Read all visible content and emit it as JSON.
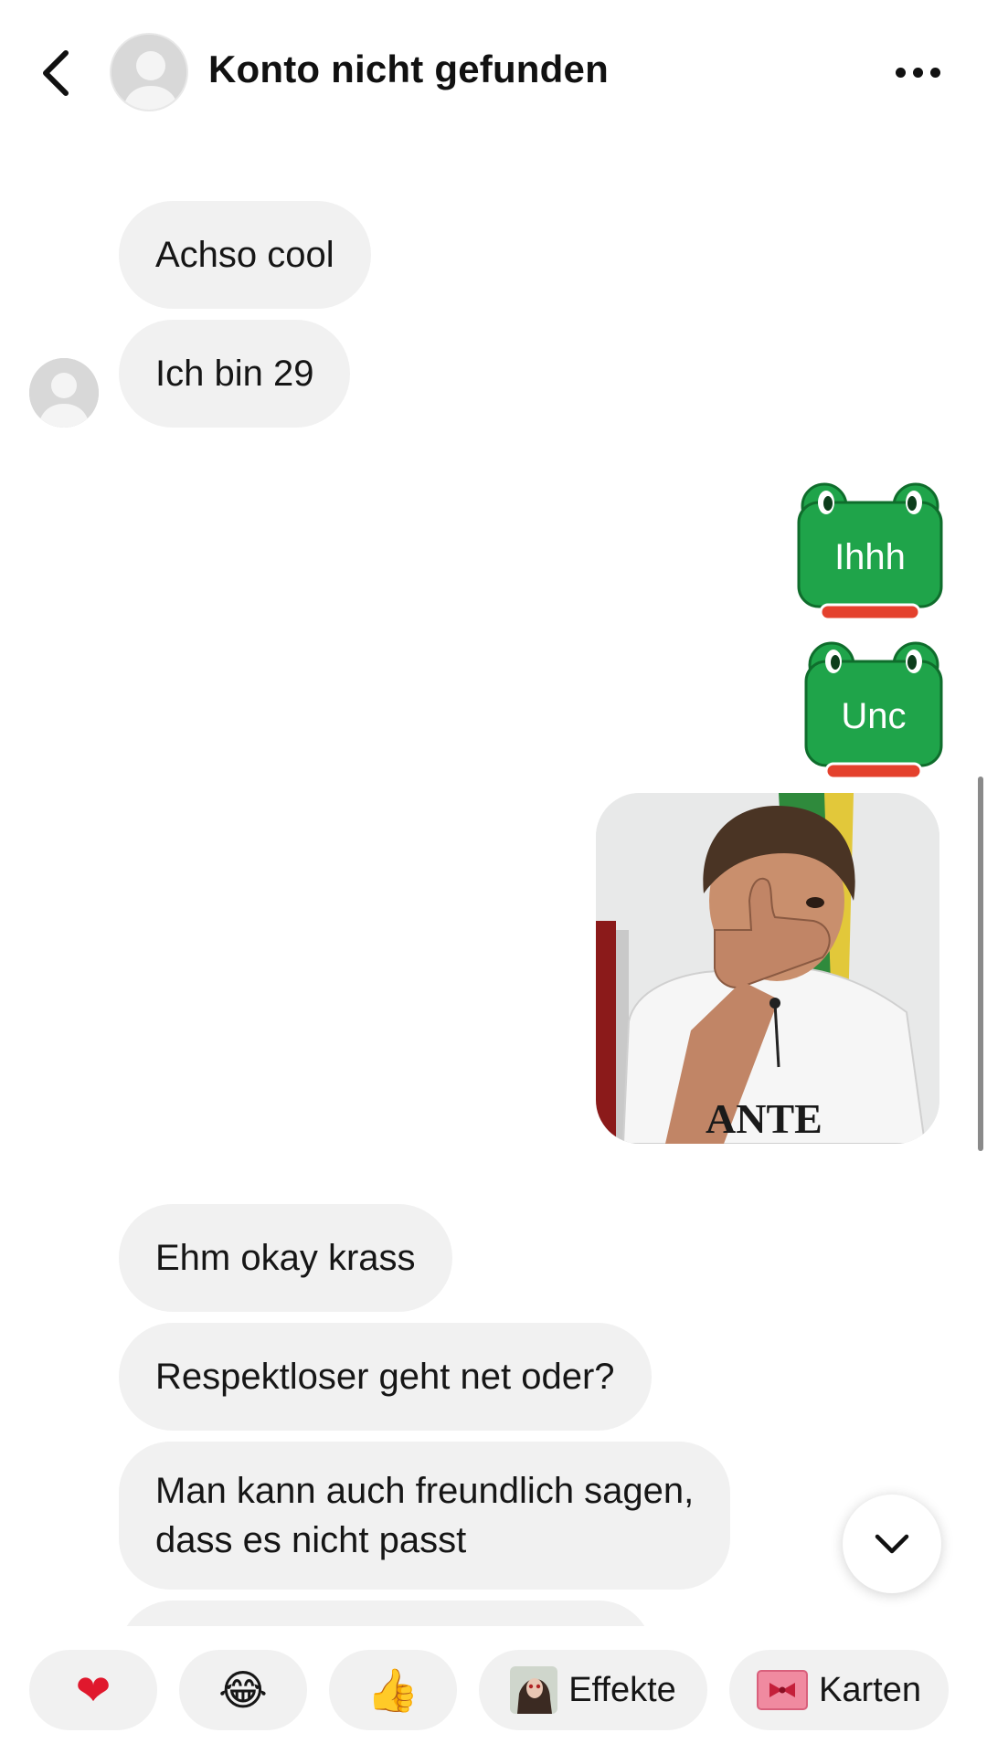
{
  "header": {
    "title": "Konto nicht gefunden"
  },
  "messages": {
    "m1": "Achso cool",
    "m2": "Ich bin 29",
    "sticker1": "Ihhh",
    "sticker2": "Unc",
    "photo_text": "ANTE",
    "m3": "Ehm okay krass",
    "m4": "Respektloser geht net oder?",
    "m5_line1": "Man kann auch freundlich sagen,",
    "m5_line2": "dass es nicht passt"
  },
  "reactions": {
    "heart": "❤",
    "laugh": "😂",
    "thumbs": "👍",
    "effects_label": "Effekte",
    "cards_label": "Karten"
  },
  "colors": {
    "sticker_green": "#1fa44a",
    "sticker_red": "#e4412d",
    "bubble_gray": "#f1f1f1",
    "heart_red": "#e0182d"
  },
  "icons": {
    "back": "chevron-left-icon",
    "more": "more-horizontal-icon",
    "scroll_down": "chevron-down-icon"
  }
}
